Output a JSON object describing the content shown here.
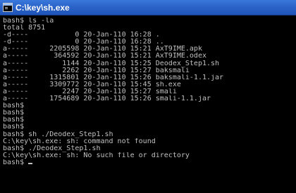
{
  "window": {
    "title": "C:\\key\\sh.exe"
  },
  "terminal": {
    "lines": [
      "bash$ ls -la",
      "total 8751",
      "-d----           0 20-Jan-110 16:28 .",
      "-d----           0 20-Jan-110 16:28 ..",
      "a-----     2205598 20-Jan-110 15:21 AxT9IME.apk",
      "a-----      364592 20-Jan-110 15:21 AxT9IME.odex",
      "a-----        1144 20-Jan-110 15:25 Deodex_Step1.sh",
      "a-----        2262 20-Jan-110 15:27 baksmali",
      "a-----     1315801 20-Jan-110 15:26 baksmali-1.1.jar",
      "a-----     3309772 20-Jan-110 15:45 sh.exe",
      "a-----        2247 20-Jan-110 15:27 smali",
      "a-----     1754689 20-Jan-110 15:26 smali-1.1.jar",
      "bash$",
      "bash$",
      "bash$",
      "bash$",
      "bash$ sh ./Deodex_Step1.sh",
      "C:\\key\\sh.exe: sh: command not found",
      "bash$ ./Deodex_Step1.sh",
      "C:\\key\\sh.exe: sh: No such file or directory",
      "bash$ "
    ]
  }
}
